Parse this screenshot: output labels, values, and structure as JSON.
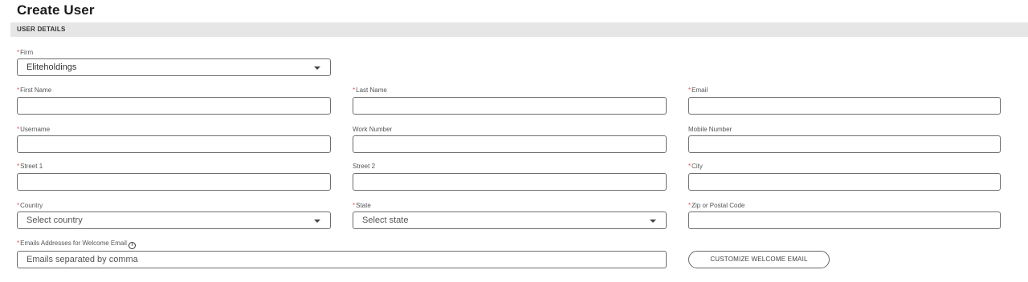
{
  "page": {
    "title": "Create User"
  },
  "section": {
    "title": "USER DETAILS"
  },
  "required_marker": "*",
  "fields": {
    "firm": {
      "label": "Firm",
      "value": "Eliteholdings"
    },
    "first_name": {
      "label": "First Name",
      "value": ""
    },
    "last_name": {
      "label": "Last Name",
      "value": ""
    },
    "email": {
      "label": "Email",
      "value": ""
    },
    "username": {
      "label": "Username",
      "value": ""
    },
    "work_number": {
      "label": "Work Number",
      "value": ""
    },
    "mobile_number": {
      "label": "Mobile Number",
      "value": ""
    },
    "street1": {
      "label": "Street 1",
      "value": ""
    },
    "street2": {
      "label": "Street 2",
      "value": ""
    },
    "city": {
      "label": "City",
      "value": ""
    },
    "country": {
      "label": "Country",
      "placeholder": "Select country"
    },
    "state": {
      "label": "State",
      "placeholder": "Select state"
    },
    "zip": {
      "label": "Zip or Postal Code",
      "value": ""
    },
    "welcome_emails": {
      "label": "Emails Addresses for Welcome Email",
      "placeholder": "Emails separated by comma"
    }
  },
  "buttons": {
    "customize_welcome_email": "CUSTOMIZE WELCOME EMAIL"
  },
  "icons": {
    "info": "info-icon",
    "dropdown": "chevron-down-icon"
  },
  "colors": {
    "required": "#e05050",
    "section_bg": "#e6e6e6",
    "border": "#6e6e6e"
  }
}
